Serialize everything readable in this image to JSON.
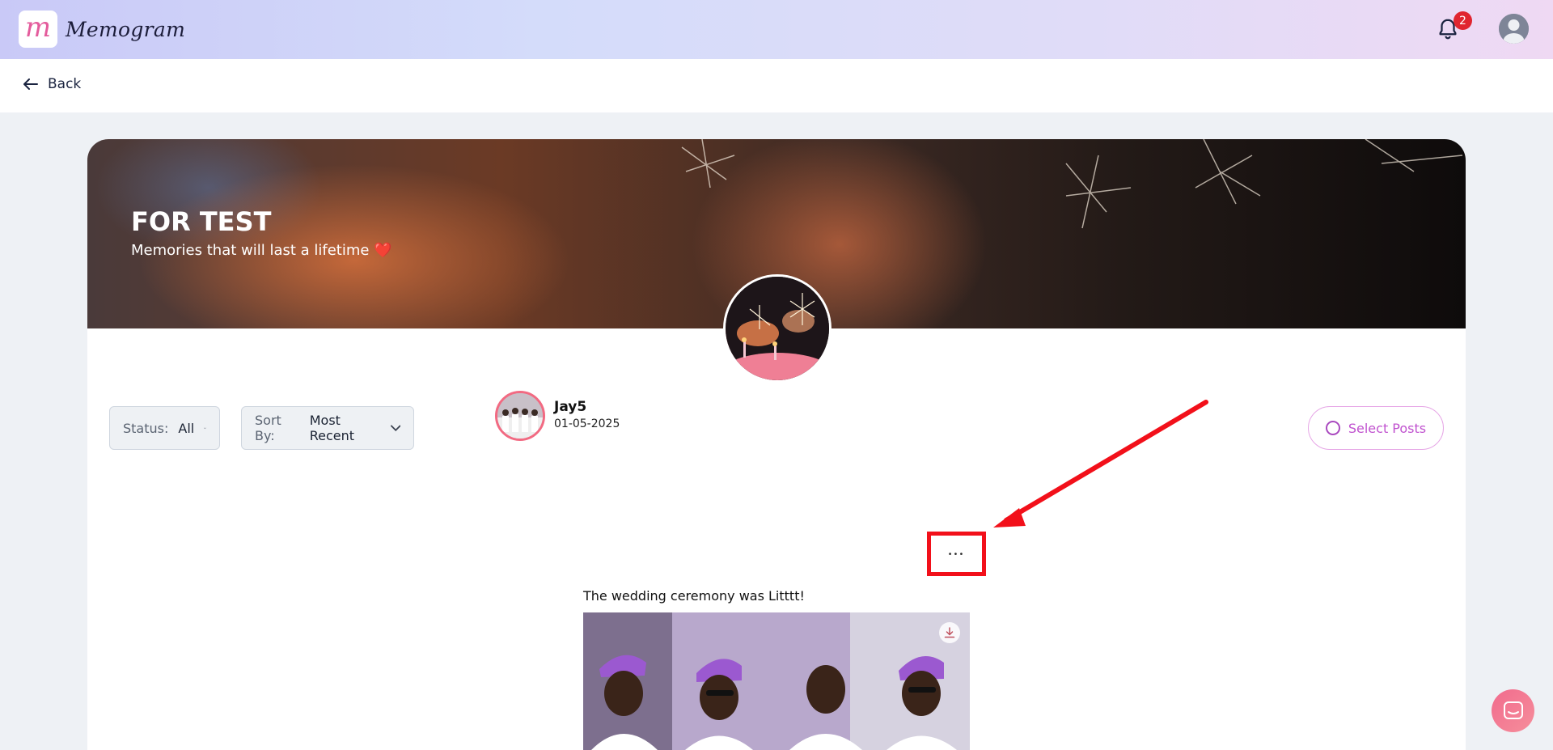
{
  "header": {
    "logo_letter": "m",
    "brand_name": "Memogram",
    "notification_count": "2"
  },
  "nav": {
    "back_label": "Back"
  },
  "banner": {
    "title": "FOR TEST",
    "subtitle": "Memories that will last a lifetime",
    "heart": "❤️"
  },
  "filters": {
    "status_label": "Status:",
    "status_value": "All",
    "sort_label": "Sort By:",
    "sort_value": "Most Recent"
  },
  "actions": {
    "select_posts_label": "Select Posts"
  },
  "post": {
    "username": "Jay5",
    "date": "01-05-2025",
    "caption": "The wedding ceremony was Litttt!",
    "more_glyph": "•••"
  },
  "colors": {
    "accent_pink": "#e45c9c",
    "select_posts": "#c052cf",
    "badge_red": "#e0252f",
    "annotation_red": "#f2101a"
  },
  "icons": [
    "bell-icon",
    "avatar-icon",
    "back-arrow-icon",
    "chevron-down-icon",
    "circle-select-icon",
    "more-icon",
    "download-icon",
    "chat-icon"
  ]
}
